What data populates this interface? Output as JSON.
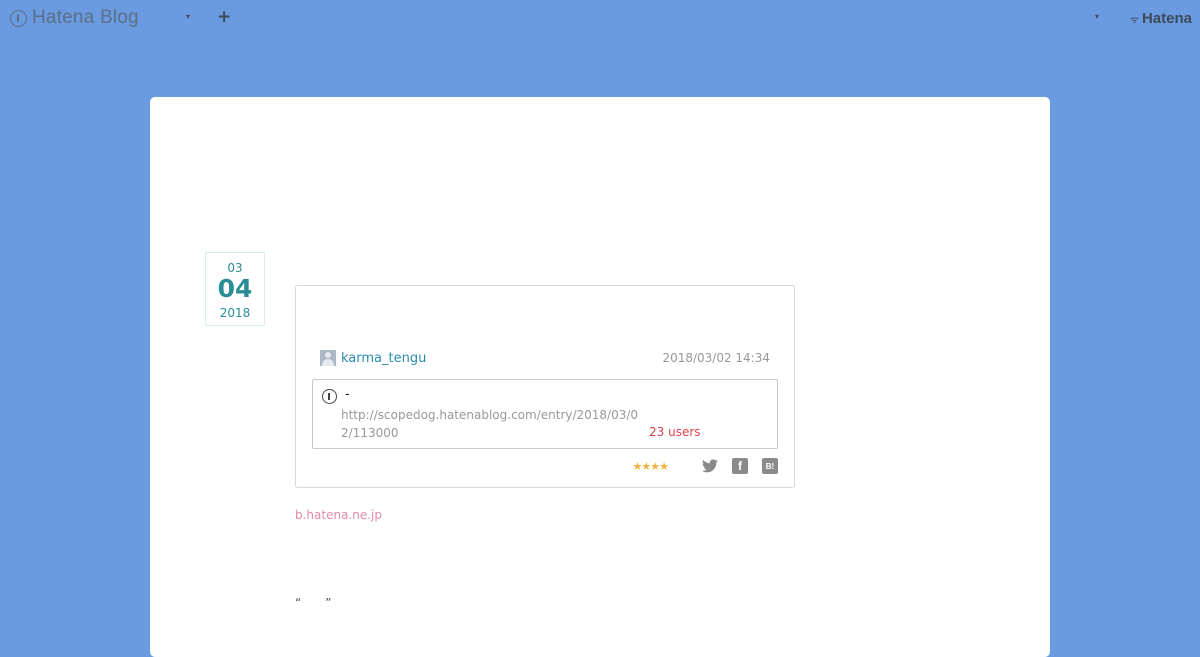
{
  "header": {
    "logo_text": "Hatena Blog",
    "caret_glyph": "▾",
    "plus_glyph": "+",
    "brand_text": "Hatena"
  },
  "date": {
    "month": "03",
    "day": "04",
    "year": "2018"
  },
  "embed": {
    "username": "karma_tengu",
    "timestamp": "2018/03/02 14:34",
    "bookmark": {
      "title": "-",
      "url": "http://scopedog.hatenablog.com/entry/2018/03/02/113000",
      "users": "23 users"
    },
    "stars": "★★★★"
  },
  "footer": {
    "source_link": "b.hatena.ne.jp",
    "quote": "“　　”"
  },
  "colors": {
    "background": "#6a9be0",
    "accent_teal": "#2b8c96",
    "link_blue": "#2a8bb0",
    "users_red": "#e0424e",
    "star_gold": "#f0b43c",
    "source_pink": "#e28aa6"
  },
  "icons": [
    "hatena-blog-logo-icon",
    "dropdown-caret-icon",
    "plus-icon",
    "hatena-icon",
    "avatar-icon",
    "hatena-bookmark-icon",
    "twitter-icon",
    "facebook-icon",
    "hatebu-icon"
  ]
}
